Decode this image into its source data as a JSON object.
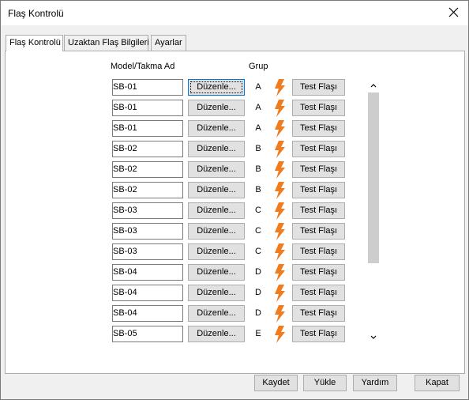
{
  "window": {
    "title": "Flaş Kontrolü"
  },
  "tabs": [
    "Flaş Kontrolü",
    "Uzaktan Flaş Bilgileri",
    "Ayarlar"
  ],
  "headers": {
    "name": "Model/Takma Ad",
    "group": "Grup"
  },
  "edit_label": "Düzenle...",
  "test_label": "Test Flaşı",
  "flash_color": "#f07c1e",
  "rows": [
    {
      "name": "SB-01",
      "group": "A"
    },
    {
      "name": "SB-01",
      "group": "A"
    },
    {
      "name": "SB-01",
      "group": "A"
    },
    {
      "name": "SB-02",
      "group": "B"
    },
    {
      "name": "SB-02",
      "group": "B"
    },
    {
      "name": "SB-02",
      "group": "B"
    },
    {
      "name": "SB-03",
      "group": "C"
    },
    {
      "name": "SB-03",
      "group": "C"
    },
    {
      "name": "SB-03",
      "group": "C"
    },
    {
      "name": "SB-04",
      "group": "D"
    },
    {
      "name": "SB-04",
      "group": "D"
    },
    {
      "name": "SB-04",
      "group": "D"
    },
    {
      "name": "SB-05",
      "group": "E"
    }
  ],
  "footer": {
    "save": "Kaydet",
    "load": "Yükle",
    "help": "Yardım",
    "close": "Kapat"
  }
}
